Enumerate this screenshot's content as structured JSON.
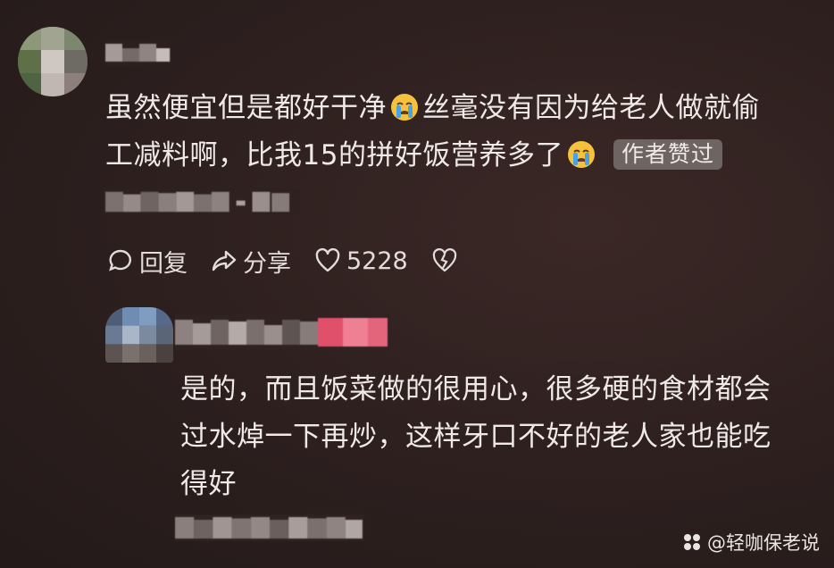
{
  "comments": [
    {
      "text_line1_a": "虽然便宜但是都好干净",
      "text_line1_b": "丝毫没有因为给老人做就偷",
      "text_line2_a": "工减料啊，比我15的拼好饭营养多了",
      "badge": "作者赞过",
      "actions": {
        "reply": "回复",
        "share": "分享",
        "likes": "5228"
      }
    },
    {
      "text_line1": "是的，而且饭菜做的很用心，很多硬的食材都会",
      "text_line2": "过水焯一下再炒，这样牙口不好的老人家也能吃",
      "text_line3": "得好"
    }
  ],
  "watermark": "@轻咖保老说",
  "icons": {
    "emoji": "crying-face-icon",
    "reply": "comment-bubble-icon",
    "share": "share-arrow-icon",
    "like": "heart-icon",
    "dislike": "broken-heart-icon",
    "watermark": "watermark-logo-icon"
  },
  "colors": {
    "badge_bg": "#6e6462",
    "emoji_face": "#f6c23e",
    "emoji_tear": "#4aa3df",
    "name_tag": "#e0506a"
  }
}
